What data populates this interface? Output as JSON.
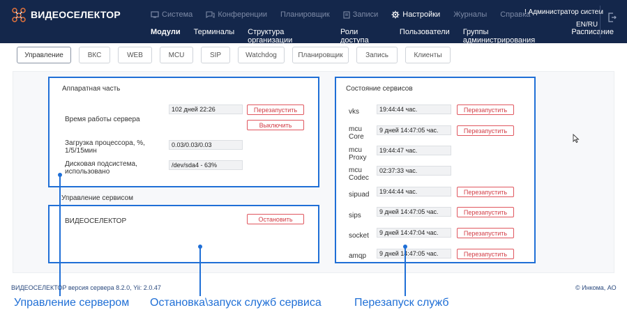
{
  "brand": {
    "name": "ВИДЕОСЕЛЕКТОР"
  },
  "top_nav": [
    {
      "label": "Система",
      "icon": "system-icon",
      "active": false
    },
    {
      "label": "Конференции",
      "icon": "conference-icon",
      "active": false
    },
    {
      "label": "Планировщик",
      "icon": "",
      "active": false
    },
    {
      "label": "Записи",
      "icon": "records-icon",
      "active": false
    },
    {
      "label": "Настройки",
      "icon": "gear-icon",
      "active": true
    },
    {
      "label": "Журналы",
      "icon": "",
      "active": false
    },
    {
      "label": "Справка",
      "icon": "",
      "active": false
    }
  ],
  "sub_nav": [
    {
      "label": "Модули",
      "active": true
    },
    {
      "label": "Терминалы",
      "active": false
    },
    {
      "label": "Структура организации",
      "active": false
    },
    {
      "label": "Роли доступа",
      "active": false
    },
    {
      "label": "Пользователи",
      "active": false
    },
    {
      "label": "Группы администрирования",
      "active": false
    },
    {
      "label": "Расписание",
      "active": false
    }
  ],
  "user": {
    "label": "! Администратор систем"
  },
  "lang": {
    "label": "EN/RU"
  },
  "tabs": [
    {
      "label": "Управление",
      "active": true
    },
    {
      "label": "ВКС",
      "active": false
    },
    {
      "label": "WEB",
      "active": false
    },
    {
      "label": "MCU",
      "active": false
    },
    {
      "label": "SIP",
      "active": false
    },
    {
      "label": "Watchdog",
      "active": false
    },
    {
      "label": "Планировщик",
      "active": false
    },
    {
      "label": "Запись",
      "active": false
    },
    {
      "label": "Клиенты",
      "active": false
    }
  ],
  "hardware": {
    "title": "Аппаратная часть",
    "rows": [
      {
        "label": "Время работы сервера",
        "value": "102 дней 22:26"
      },
      {
        "label": "Загрузка процессора, %, 1/5/15мин",
        "value": "0.03/0.03/0.03"
      },
      {
        "label": "Дисковая подсистема, использовано",
        "value": "/dev/sda4 - 63%"
      }
    ],
    "buttons": {
      "restart": "Перезапустить",
      "shutdown": "Выключить"
    }
  },
  "service_mgmt": {
    "title": "Управление сервисом",
    "service_name": "ВИДЕОСЕЛЕКТОР",
    "stop_button": "Остановить"
  },
  "services": {
    "title": "Состояние сервисов",
    "restart_label": "Перезапустить",
    "items": [
      {
        "name": "vks",
        "uptime": "19:44:44 час.",
        "restart": true
      },
      {
        "name": "mcu Core",
        "uptime": "9 дней 14:47:05 час.",
        "restart": true
      },
      {
        "name": "mcu Proxy",
        "uptime": "19:44:47 час.",
        "restart": false
      },
      {
        "name": "mcu Codec",
        "uptime": "02:37:33 час.",
        "restart": false
      },
      {
        "name": "sipuad",
        "uptime": "19:44:44 час.",
        "restart": true
      },
      {
        "name": "sips",
        "uptime": "9 дней 14:47:05 час.",
        "restart": true
      },
      {
        "name": "socket",
        "uptime": "9 дней 14:47:04 час.",
        "restart": true
      },
      {
        "name": "amqp",
        "uptime": "9 дней 14:47:05 час.",
        "restart": true
      }
    ]
  },
  "footer": {
    "version": "ВИДЕОСЕЛЕКТОР версия сервера 8.2.0, Yii: 2.0.47",
    "copyright": "© Инкома, АО"
  },
  "annotations": [
    {
      "text": "Управление сервером"
    },
    {
      "text": "Остановка\\запуск служб сервиса"
    },
    {
      "text": "Перезапуск служб"
    }
  ],
  "colors": {
    "header_bg": "#14274b",
    "frame": "#1f6fd6",
    "danger": "#d23c45",
    "footer_text": "#2b4a7e"
  }
}
